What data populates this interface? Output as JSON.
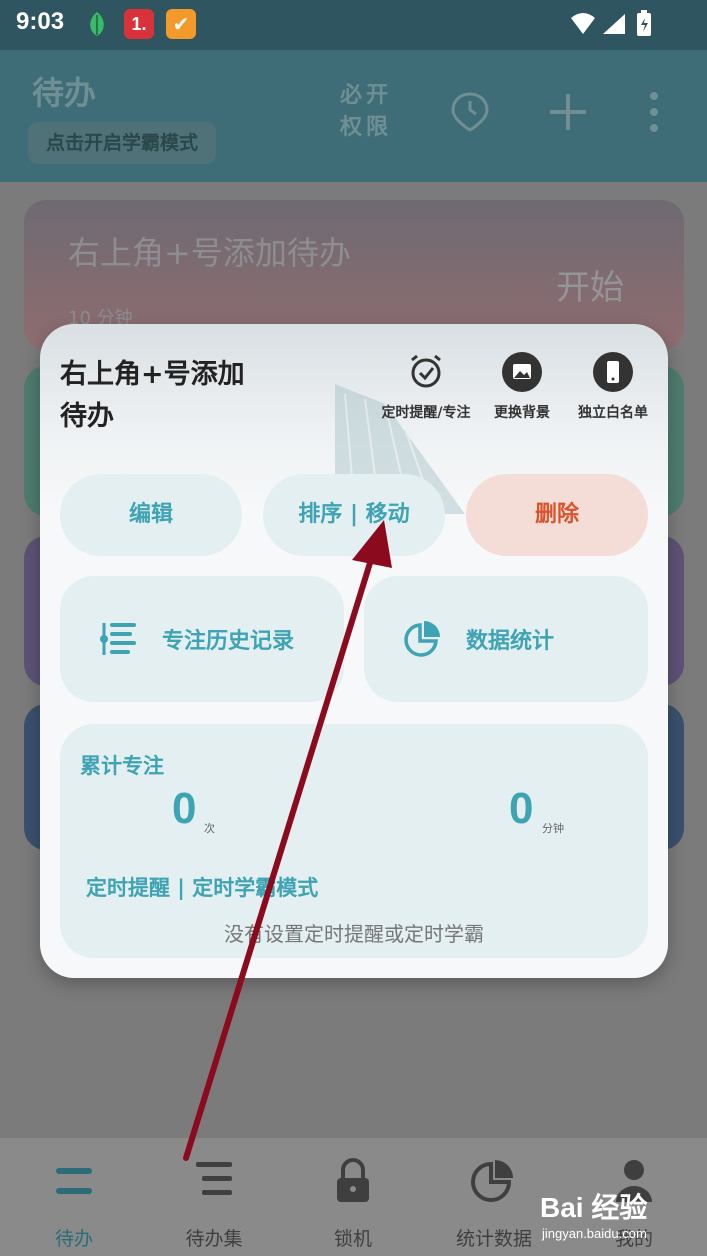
{
  "status_bar": {
    "time": "9:03",
    "app_badge": "1."
  },
  "header": {
    "title": "待办",
    "study_mode_button": "点击开启学霸模式",
    "permission_line1": "必开",
    "permission_line2": "权限"
  },
  "list": {
    "first_card_title": "右上角+号添加待办",
    "first_card_start": "开始",
    "first_card_duration": "10 分钟"
  },
  "popup": {
    "title_line1": "右上角+号添加",
    "title_line2": "待办",
    "tools": [
      {
        "label": "定时提醒/专注",
        "icon": "alarm-clock-icon"
      },
      {
        "label": "更换背景",
        "icon": "image-icon"
      },
      {
        "label": "独立白名单",
        "icon": "phone-icon"
      }
    ],
    "edit_label": "编辑",
    "sort_label": "排序 | 移动",
    "delete_label": "删除",
    "history_label": "专注历史记录",
    "stats_label": "数据统计",
    "summary": {
      "heading": "累计专注",
      "count": "0",
      "count_unit": "次",
      "minutes": "0",
      "minutes_unit": "分钟",
      "reminder_heading": "定时提醒 | 定时学霸模式",
      "empty_text": "没有设置定时提醒或定时学霸"
    }
  },
  "bottom_nav": [
    {
      "label": "待办",
      "icon": "todo-icon",
      "active": true
    },
    {
      "label": "待办集",
      "icon": "todo-set-icon",
      "active": false
    },
    {
      "label": "锁机",
      "icon": "lock-icon",
      "active": false
    },
    {
      "label": "统计数据",
      "icon": "pie-chart-icon",
      "active": false
    },
    {
      "label": "我的",
      "icon": "user-icon",
      "active": false
    }
  ],
  "watermark": {
    "brand": "Bai 经验",
    "url": "jingyan.baidu.com"
  },
  "colors": {
    "accent": "#3ea3b3",
    "delete": "#d9532c",
    "arrow": "#8b0a1e"
  }
}
